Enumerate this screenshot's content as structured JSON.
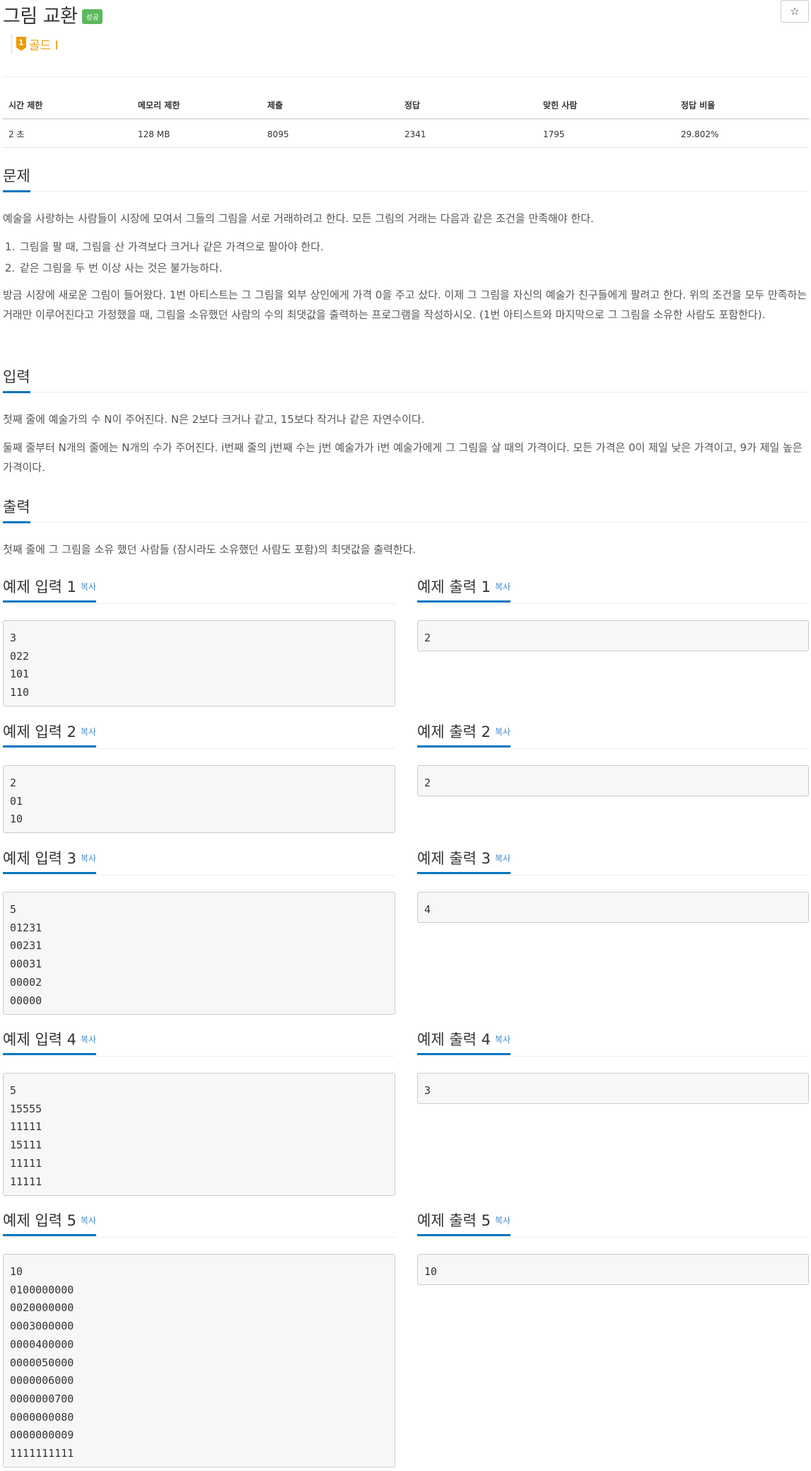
{
  "problem": {
    "title": "그림 교환",
    "status_badge": "성공",
    "star_icon": "☆",
    "tier_icon_text": "1",
    "tier_label": "골드 I"
  },
  "info_table": {
    "headers": [
      "시간 제한",
      "메모리 제한",
      "제출",
      "정답",
      "맞힌 사람",
      "정답 비율"
    ],
    "values": [
      "2 초",
      "128 MB",
      "8095",
      "2341",
      "1795",
      "29.802%"
    ]
  },
  "sections": {
    "problem_title": "문제",
    "problem_intro": "예술을 사랑하는 사람들이 시장에 모여서 그들의 그림을 서로 거래하려고 한다. 모든 그림의 거래는 다음과 같은 조건을 만족해야 한다.",
    "rules": [
      "그림을 팔 때, 그림을 산 가격보다 크거나 같은 가격으로 팔아야 한다.",
      "같은 그림을 두 번 이상 사는 것은 불가능하다."
    ],
    "problem_body": "방금 시장에 새로운 그림이 들어왔다. 1번 아티스트는 그 그림을 외부 상인에게 가격 0을 주고 샀다. 이제 그 그림을 자신의 예술가 친구들에게 팔려고 한다. 위의 조건을 모두 만족하는 거래만 이루어진다고 가정했을 때, 그림을 소유했던 사람의 수의 최댓값을 출력하는 프로그램을 작성하시오. (1번 아티스트와 마지막으로 그 그림을 소유한 사람도 포함한다).",
    "input_title": "입력",
    "input_p1": "첫째 줄에 예술가의 수 N이 주어진다. N은 2보다 크거나 같고, 15보다 작거나 같은 자연수이다.",
    "input_p2": "둘째 줄부터 N개의 줄에는 N개의 수가 주어진다. i번째 줄의 j번째 수는 j번 예술가가 i번 예술가에게 그 그림을 살 때의 가격이다. 모든 가격은 0이 제일 낮은 가격이고, 9가 제일 높은 가격이다.",
    "output_title": "출력",
    "output_p1": "첫째 줄에 그 그림을 소유 했던 사람들 (잠시라도 소유했던 사람도 포함)의 최댓값을 출력한다."
  },
  "samples": {
    "copy_label": "복사",
    "items": [
      {
        "input_title": "예제 입력 1",
        "output_title": "예제 출력 1",
        "input": "3\n022\n101\n110",
        "output": "2"
      },
      {
        "input_title": "예제 입력 2",
        "output_title": "예제 출력 2",
        "input": "2\n01\n10",
        "output": "2"
      },
      {
        "input_title": "예제 입력 3",
        "output_title": "예제 출력 3",
        "input": "5\n01231\n00231\n00031\n00002\n00000",
        "output": "4"
      },
      {
        "input_title": "예제 입력 4",
        "output_title": "예제 출력 4",
        "input": "5\n15555\n11111\n15111\n11111\n11111",
        "output": "3"
      },
      {
        "input_title": "예제 입력 5",
        "output_title": "예제 출력 5",
        "input": "10\n0100000000\n0020000000\n0003000000\n0000400000\n0000050000\n0000006000\n0000000700\n0000000080\n0000000009\n1111111111",
        "output": "10"
      }
    ]
  }
}
